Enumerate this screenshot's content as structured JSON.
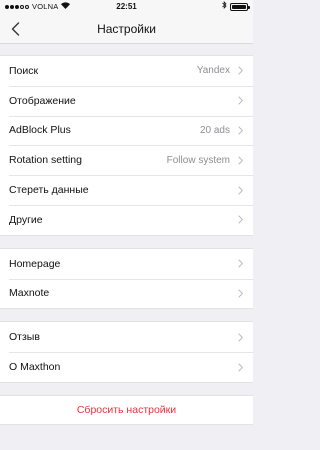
{
  "status_bar": {
    "carrier": "VOLNA",
    "time": "22:51",
    "signal_icon": "signal-dots-icon",
    "wifi_icon": "wifi-icon",
    "bluetooth_icon": "bluetooth-icon",
    "battery_icon": "battery-icon"
  },
  "nav": {
    "title": "Настройки",
    "back_icon": "chevron-left-icon"
  },
  "groups": [
    {
      "items": [
        {
          "label": "Поиск",
          "value": "Yandex"
        },
        {
          "label": "Отображение",
          "value": ""
        },
        {
          "label": "AdBlock Plus",
          "value": "20 ads"
        },
        {
          "label": "Rotation setting",
          "value": "Follow system"
        },
        {
          "label": "Стереть данные",
          "value": ""
        },
        {
          "label": "Другие",
          "value": ""
        }
      ]
    },
    {
      "items": [
        {
          "label": "Homepage",
          "value": ""
        },
        {
          "label": "Maxnote",
          "value": ""
        }
      ]
    },
    {
      "items": [
        {
          "label": "Отзыв",
          "value": ""
        },
        {
          "label": "О Maxthon",
          "value": ""
        }
      ]
    }
  ],
  "reset": {
    "label": "Сбросить настройки",
    "color": "#e8323c"
  },
  "colors": {
    "background": "#efeff4",
    "secondary_text": "#8e8e93"
  }
}
